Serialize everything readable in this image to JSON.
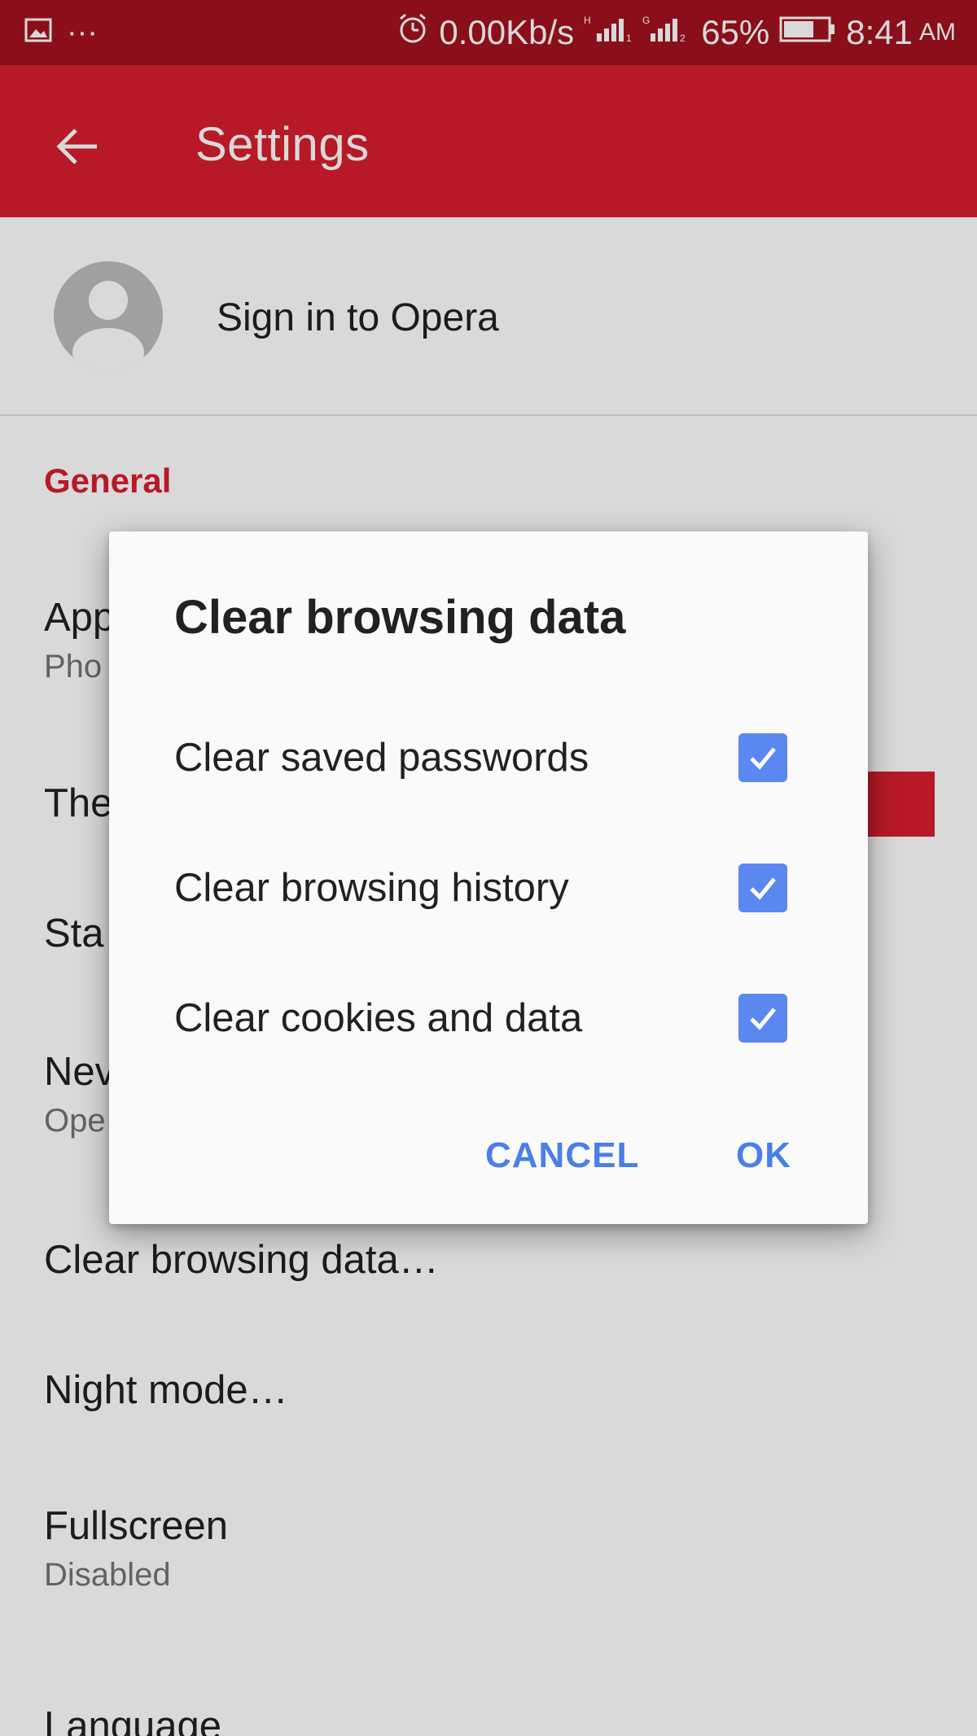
{
  "status_bar": {
    "speed": "0.00Kb/s",
    "battery": "65%",
    "time": "8:41",
    "ampm": "AM",
    "overflow_dots": "···"
  },
  "app_bar": {
    "title": "Settings"
  },
  "account": {
    "sign_in_label": "Sign in to Opera"
  },
  "sections": {
    "general_header": "General"
  },
  "settings": [
    {
      "title": "App",
      "subtitle": "Pho"
    },
    {
      "title": "The"
    },
    {
      "title": "Sta"
    },
    {
      "title": "Nev",
      "subtitle": "Ope"
    },
    {
      "title": "Clear browsing data…"
    },
    {
      "title": "Night mode…"
    },
    {
      "title": "Fullscreen",
      "subtitle": "Disabled"
    },
    {
      "title": "Language"
    }
  ],
  "dialog": {
    "title": "Clear browsing data",
    "options": [
      {
        "label": "Clear saved passwords",
        "checked": true
      },
      {
        "label": "Clear browsing history",
        "checked": true
      },
      {
        "label": "Clear cookies and data",
        "checked": true
      }
    ],
    "cancel_label": "CANCEL",
    "ok_label": "OK"
  },
  "colors": {
    "status_bar": "#a3121f",
    "app_bar": "#d81e2e",
    "accent": "#d81e2e",
    "checkbox": "#5b87f0",
    "dialog_button": "#4a7fe8"
  }
}
